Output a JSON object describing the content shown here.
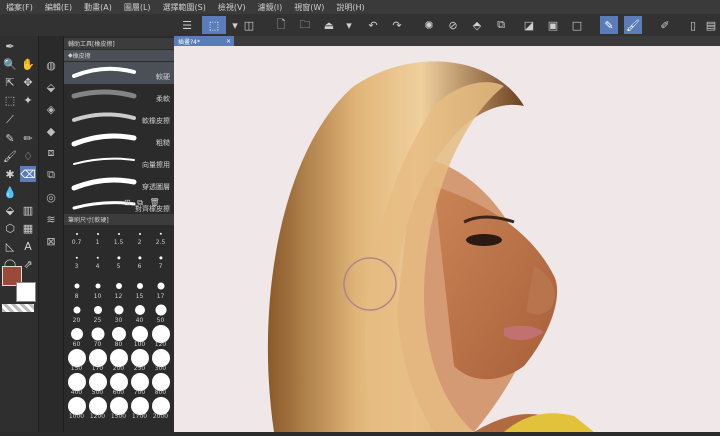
{
  "menu": [
    "檔案(F)",
    "編輯(E)",
    "動畫(A)",
    "圖層(L)",
    "選擇範圍(S)",
    "檢視(V)",
    "濾鏡(I)",
    "視窗(W)",
    "說明(H)"
  ],
  "canvas_tab": {
    "title": "插畫?4*",
    "close": "×"
  },
  "panel": {
    "subtool_title": "輔助工具[橡皮擦]",
    "eraser_group": "橡皮擦",
    "brushes": [
      "較硬",
      "柔軟",
      "軟橡皮擦",
      "粗糙",
      "向量擦用",
      "穿透圖層",
      "對齊橡皮擦"
    ],
    "size_title": "筆刷尺寸[軟硬]"
  },
  "sizes": [
    "0.7",
    "1",
    "1.5",
    "2",
    "2.5",
    "3",
    "4",
    "5",
    "6",
    "7",
    "8",
    "10",
    "12",
    "15",
    "17",
    "20",
    "25",
    "30",
    "40",
    "50",
    "60",
    "70",
    "80",
    "100",
    "120",
    "150",
    "170",
    "200",
    "250",
    "300",
    "400",
    "500",
    "600",
    "700",
    "800",
    "1000",
    "1200",
    "1500",
    "1700",
    "2000"
  ],
  "colors": {
    "main": "#9b4a3a",
    "sub": "#ffffff",
    "accent": "#5a7cb8"
  },
  "icons": {
    "menu": "hamburger-icon",
    "undo": "undo-icon",
    "redo": "redo-icon"
  }
}
